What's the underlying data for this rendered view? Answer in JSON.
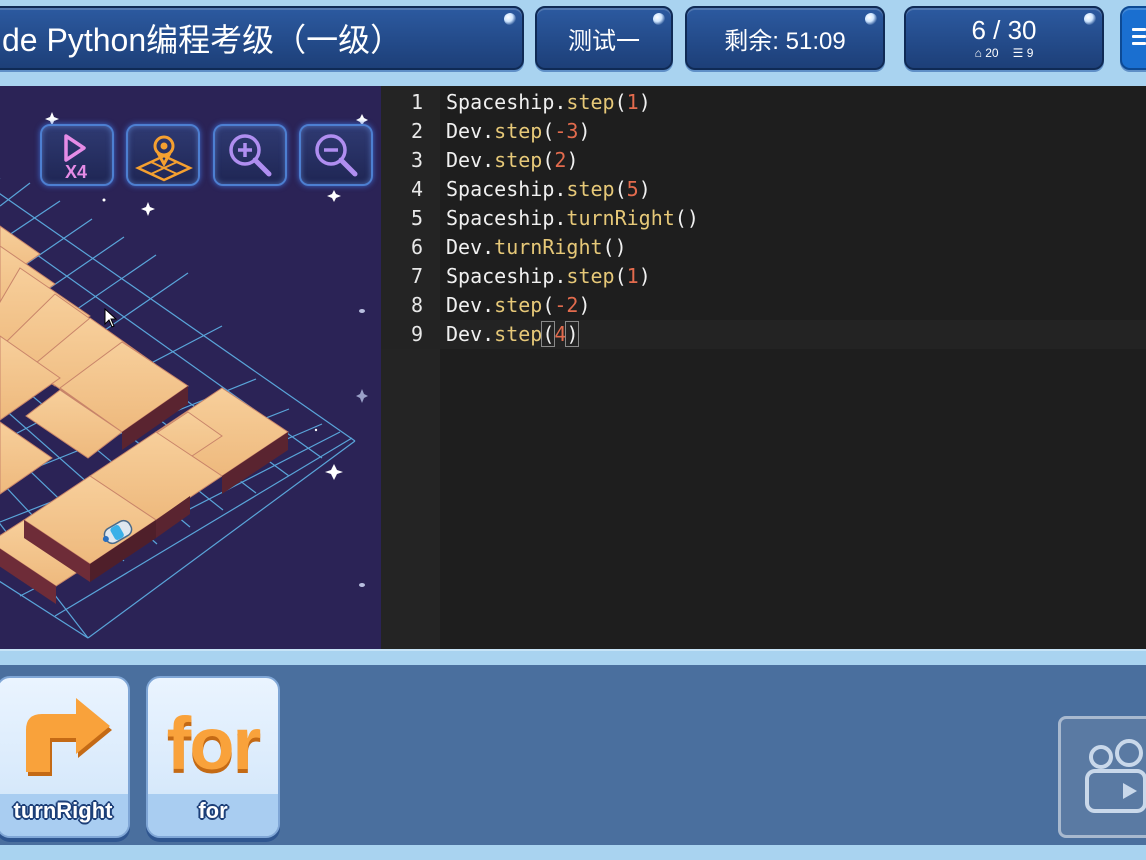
{
  "header": {
    "title": "de Python编程考级（一级）",
    "test_label": "测试一",
    "timer_label": "剩余: 51:09",
    "progress": "6 / 30",
    "stat_a_icon": "flask-icon",
    "stat_a": "20",
    "stat_b_icon": "list-icon",
    "stat_b": "9"
  },
  "game": {
    "tools": [
      {
        "name": "speed-x4-icon",
        "label": "X4"
      },
      {
        "name": "locate-map-icon"
      },
      {
        "name": "zoom-in-icon"
      },
      {
        "name": "zoom-out-icon"
      }
    ],
    "character": "spaceship-icon"
  },
  "editor": {
    "lines": [
      {
        "n": "1",
        "obj": "Spaceship",
        "fn": "step",
        "arg": "1"
      },
      {
        "n": "2",
        "obj": "Dev",
        "fn": "step",
        "arg": "-3"
      },
      {
        "n": "3",
        "obj": "Dev",
        "fn": "step",
        "arg": "2"
      },
      {
        "n": "4",
        "obj": "Spaceship",
        "fn": "step",
        "arg": "5"
      },
      {
        "n": "5",
        "obj": "Spaceship",
        "fn": "turnRight",
        "arg": ""
      },
      {
        "n": "6",
        "obj": "Dev",
        "fn": "turnRight",
        "arg": ""
      },
      {
        "n": "7",
        "obj": "Spaceship",
        "fn": "step",
        "arg": "1"
      },
      {
        "n": "8",
        "obj": "Dev",
        "fn": "step",
        "arg": "-2"
      },
      {
        "n": "9",
        "obj": "Dev",
        "fn": "step",
        "arg": "4"
      }
    ],
    "active_line": "9"
  },
  "palette": {
    "cards": [
      {
        "icon": "turn-right-arrow-icon",
        "label": "turnRight"
      },
      {
        "icon_text": "for",
        "label": "for"
      }
    ],
    "video_icon": "video-camera-icon"
  },
  "colors": {
    "header_bg": "#a9d3f0",
    "pill": "#24508f",
    "editor_bg": "#1e1e1e",
    "fn": "#e6c878",
    "num": "#e36b4d",
    "space_bg": "#2b2356",
    "tile": "#f3c58f",
    "grid": "#5fb3e8"
  }
}
